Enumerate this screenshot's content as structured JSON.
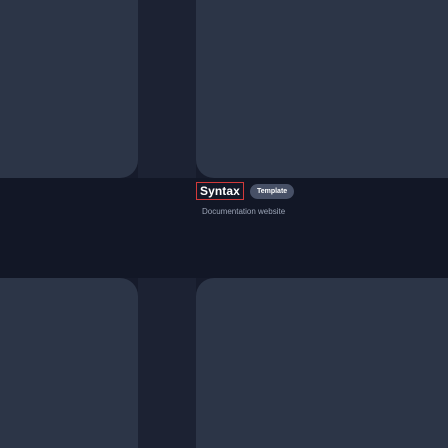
{
  "card": {
    "brand": "Syntax",
    "badge": "Template",
    "subtitle": "Documentation website"
  },
  "colors": {
    "background": "#161b2b",
    "panel": "#2c3547",
    "band": "#121726",
    "badge_bg": "#475066",
    "brand_outline": "#d33a3a",
    "subtitle_text": "#9aa3b5"
  }
}
